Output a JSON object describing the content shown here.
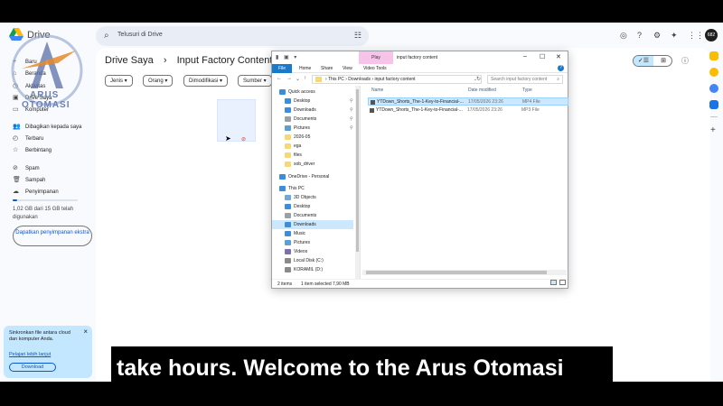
{
  "app": {
    "name": "Drive",
    "search_placeholder": "Telusuri di Drive",
    "avatar": "682"
  },
  "logo": {
    "line1": "ARUS",
    "line2": "OTOMASI"
  },
  "sidebar": {
    "items": [
      {
        "icon": "new-icon",
        "label": "Baru"
      },
      {
        "icon": "home-icon",
        "label": "Beranda"
      },
      {
        "icon": "activity-icon",
        "label": "Aktivitas"
      },
      {
        "icon": "my-drive-icon",
        "label": "Drive Saya"
      },
      {
        "icon": "computer-icon",
        "label": "Komputer"
      },
      {
        "icon": "shared-icon",
        "label": "Dibagikan kepada saya"
      },
      {
        "icon": "recent-icon",
        "label": "Terbaru"
      },
      {
        "icon": "star-icon",
        "label": "Berbintang"
      },
      {
        "icon": "spam-icon",
        "label": "Spam"
      },
      {
        "icon": "trash-icon",
        "label": "Sampah"
      },
      {
        "icon": "cloud-icon",
        "label": "Penyimpanan"
      }
    ],
    "storage_text": "1,02 GB dari 15 GB telah digunakan",
    "storage_fraction": 0.068,
    "buy_storage": "Dapatkan penyimpanan ekstra"
  },
  "sync_card": {
    "text": "Sinkronkan file antara cloud dan komputer Anda.",
    "link": "Pelajari lebih lanjut",
    "button": "Download",
    "close": "×"
  },
  "main": {
    "breadcrumb_root": "Drive Saya",
    "breadcrumb_sep": "›",
    "breadcrumb_current": "Input Factory Content",
    "breadcrumb_caret": "▾",
    "filters": [
      "Jenis",
      "Orang",
      "Dimodifikasi",
      "Sumber"
    ]
  },
  "explorer": {
    "title": "input factory content",
    "play_tab": "Play",
    "tabs": [
      "File",
      "Home",
      "Share",
      "View",
      "Video Tools"
    ],
    "address": [
      "This PC",
      "Downloads",
      "input factory content"
    ],
    "search_placeholder": "Search input factory content",
    "nav_items": [
      {
        "label": "Quick access",
        "icon": "star",
        "indent": 0,
        "pin": false
      },
      {
        "label": "Desktop",
        "icon": "desktop",
        "indent": 1,
        "pin": true
      },
      {
        "label": "Downloads",
        "icon": "download",
        "indent": 1,
        "pin": true
      },
      {
        "label": "Documents",
        "icon": "doc",
        "indent": 1,
        "pin": true
      },
      {
        "label": "Pictures",
        "icon": "pic",
        "indent": 1,
        "pin": true
      },
      {
        "label": "2026-05",
        "icon": "folder",
        "indent": 1,
        "pin": false
      },
      {
        "label": "ega",
        "icon": "folder",
        "indent": 1,
        "pin": false
      },
      {
        "label": "files",
        "icon": "folder",
        "indent": 1,
        "pin": false
      },
      {
        "label": "sob_driver",
        "icon": "folder",
        "indent": 1,
        "pin": false
      },
      {
        "label": "OneDrive - Personal",
        "icon": "cloud",
        "indent": 0,
        "pin": false
      },
      {
        "label": "This PC",
        "icon": "pc",
        "indent": 0,
        "pin": false
      },
      {
        "label": "3D Objects",
        "icon": "obj",
        "indent": 1,
        "pin": false
      },
      {
        "label": "Desktop",
        "icon": "desktop",
        "indent": 1,
        "pin": false
      },
      {
        "label": "Documents",
        "icon": "doc",
        "indent": 1,
        "pin": false
      },
      {
        "label": "Downloads",
        "icon": "download",
        "indent": 1,
        "pin": false
      },
      {
        "label": "Music",
        "icon": "music",
        "indent": 1,
        "pin": false
      },
      {
        "label": "Pictures",
        "icon": "pic",
        "indent": 1,
        "pin": false
      },
      {
        "label": "Videos",
        "icon": "video",
        "indent": 1,
        "pin": false
      },
      {
        "label": "Local Disk (C:)",
        "icon": "disk",
        "indent": 1,
        "pin": false
      },
      {
        "label": "KORAMIL (D:)",
        "icon": "disk",
        "indent": 1,
        "pin": false
      }
    ],
    "selected_nav_index": 14,
    "columns": [
      "Name",
      "Date modified",
      "Type"
    ],
    "files": [
      {
        "name": "YTDown_Shorts_The-1-Key-to-Financial-...",
        "date": "17/05/2026 23:26",
        "type": "MP4 File",
        "selected": true
      },
      {
        "name": "YTDown_Shorts_The-1-Key-to-Financial-...",
        "date": "17/05/2026 23:26",
        "type": "MP3 File",
        "selected": false
      }
    ],
    "status_count": "2 items",
    "status_selected": "1 item selected  7,90 MB"
  },
  "caption": "take hours. Welcome to the Arus Otomasi",
  "colors": {
    "accent": "#0b57d0",
    "selection": "#cce8ff",
    "play_tab": "#f7c3e8"
  }
}
